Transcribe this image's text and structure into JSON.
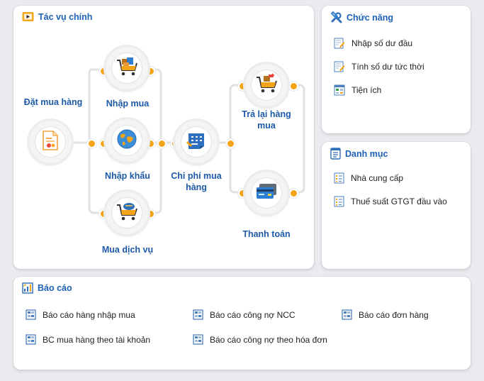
{
  "main_panel": {
    "title": "Tác vụ chính",
    "nodes": {
      "dat_mua_hang": "Đặt mua hàng",
      "nhap_mua": "Nhập mua",
      "nhap_khau": "Nhập khẩu",
      "mua_dich_vu": "Mua dịch vụ",
      "chi_phi_mua_hang": "Chi phí mua hàng",
      "tra_lai_hang_mua": "Trả lại hàng mua",
      "thanh_toan": "Thanh toán"
    },
    "colors": {
      "accent_orange": "#f4a418",
      "link_blue": "#1d5aa8",
      "connector": "#e1e1e1"
    }
  },
  "functions_panel": {
    "title": "Chức năng",
    "items": [
      "Nhập số dư đầu",
      "Tính số dư tức thời",
      "Tiện ích"
    ]
  },
  "catalog_panel": {
    "title": "Danh mục",
    "items": [
      "Nhà cung cấp",
      "Thuế suất GTGT đầu vào"
    ]
  },
  "reports_panel": {
    "title": "Báo cáo",
    "items": [
      "Báo cáo hàng nhập mua",
      "Báo cáo công nợ NCC",
      "Báo cáo đơn hàng",
      "BC mua hàng theo tài khoản",
      "Báo cáo công nợ theo hóa đơn"
    ]
  }
}
